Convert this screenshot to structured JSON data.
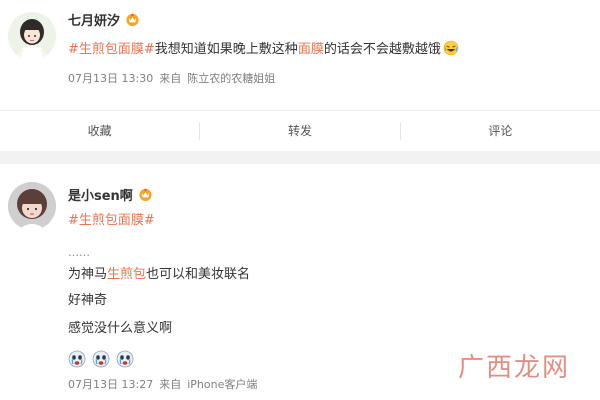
{
  "post1": {
    "username": "七月妍汐",
    "hashtag": "#生煎包面膜#",
    "text_before": "我想知道如果晚上敷这种",
    "text_highlight": "面膜",
    "text_after": "的话会不会越敷越饿",
    "emoji": "laughing-emoji",
    "time": "07月13日 13:30",
    "source_prefix": "来自",
    "source": "陈立农的农糖姐姐"
  },
  "actions": {
    "favorite": "收藏",
    "repost": "转发",
    "comment": "评论"
  },
  "post2": {
    "username": "是小sen啊",
    "hashtag": "#生煎包面膜#",
    "ellipsis": "……",
    "line1_before": "为神马",
    "line1_highlight": "生煎包",
    "line1_after": "也可以和美妆联名",
    "line2": "好神奇",
    "line3": "感觉没什么意义啊",
    "reactions": [
      "crying-face-emoji",
      "crying-face-emoji",
      "crying-face-emoji"
    ],
    "time": "07月13日 13:27",
    "source_prefix": "来自",
    "source": "iPhone客户端"
  },
  "watermark": "广西龙网",
  "colors": {
    "accent": "#eb7350",
    "meta": "#808080",
    "divider": "#f2f2f5"
  }
}
